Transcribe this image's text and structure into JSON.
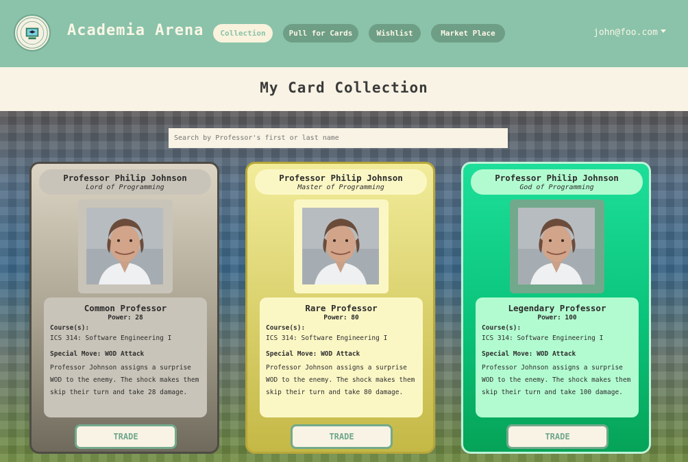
{
  "brand": {
    "name": "Academia Arena"
  },
  "nav": {
    "items": [
      {
        "label": "Collection"
      },
      {
        "label": "Pull for Cards"
      },
      {
        "label": "Wishlist"
      },
      {
        "label": "Market Place"
      }
    ],
    "user": "john@foo.com"
  },
  "page": {
    "title": "My Card Collection",
    "search_placeholder": "Search by Professor's first or last name"
  },
  "colors": {
    "nav_bg": "#8ac3a9",
    "nav_pill": "#6e9e85",
    "cream": "#f8f3e4",
    "common": "#c9c4b9",
    "rare": "#fbf7c5",
    "legendary": "#b2fbd0"
  },
  "cards": [
    {
      "name": "Professor Philip Johnson",
      "title": "Lord of Programming",
      "rarity": "Common Professor",
      "power": "Power: 28",
      "course_label": "Course(s):",
      "course": "ICS 314: Software Engineering I",
      "special_move": "Special Move: WOD Attack",
      "description": "Professor Johnson assigns a surprise WOD to the enemy. The shock makes them skip their turn and take 28 damage.",
      "button": "TRADE"
    },
    {
      "name": "Professor Philip Johnson",
      "title": "Master of Programming",
      "rarity": "Rare Professor",
      "power": "Power: 80",
      "course_label": "Course(s):",
      "course": "ICS 314: Software Engineering I",
      "special_move": "Special Move: WOD Attack",
      "description": "Professor Johnson assigns a surprise WOD to the enemy. The shock makes them skip their turn and take 80 damage.",
      "button": "TRADE"
    },
    {
      "name": "Professor Philip Johnson",
      "title": "God of Programming",
      "rarity": "Legendary Professor",
      "power": "Power: 100",
      "course_label": "Course(s):",
      "course": "ICS 314: Software Engineering I",
      "special_move": "Special Move: WOD Attack",
      "description": "Professor Johnson assigns a surprise WOD to the enemy. The shock makes them skip their turn and take 100 damage.",
      "button": "TRADE"
    }
  ]
}
